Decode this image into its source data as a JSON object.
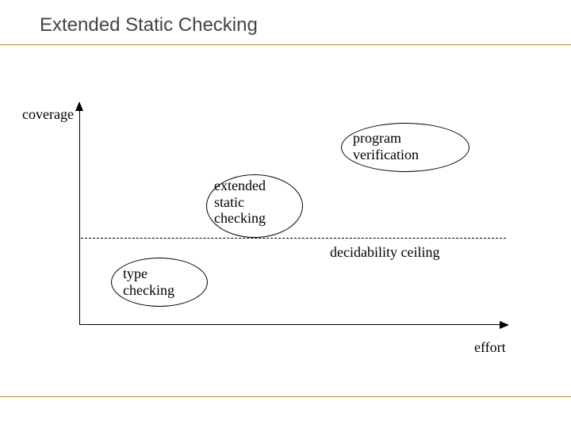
{
  "title": "Extended Static Checking",
  "axes": {
    "y": "coverage",
    "x": "effort"
  },
  "threshold_label": "decidability ceiling",
  "nodes": {
    "type_checking": "type\nchecking",
    "extended_static_checking": "extended\nstatic\nchecking",
    "program_verification": "program\nverification"
  },
  "colors": {
    "rule": "#b48a2a"
  },
  "chart_data": {
    "type": "scatter",
    "title": "Extended Static Checking",
    "xlabel": "effort",
    "ylabel": "coverage",
    "xlim": [
      0,
      1
    ],
    "ylim": [
      0,
      1
    ],
    "series": [
      {
        "name": "type checking",
        "x": 0.18,
        "y": 0.2
      },
      {
        "name": "extended static checking",
        "x": 0.42,
        "y": 0.55
      },
      {
        "name": "program verification",
        "x": 0.75,
        "y": 0.82
      }
    ],
    "annotations": [
      {
        "text": "decidability ceiling",
        "kind": "hline",
        "y": 0.4
      }
    ]
  }
}
